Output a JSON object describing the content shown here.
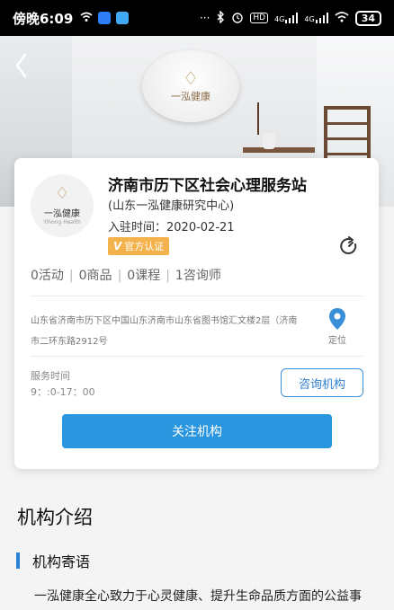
{
  "status_bar": {
    "time": "傍晚6:09",
    "dots": "···",
    "signal_1": "4G",
    "signal_2": "4G",
    "battery": "34"
  },
  "hero": {
    "plate_mark": "♢",
    "plate_brand": "一泓健康"
  },
  "org": {
    "avatar_mark": "♢",
    "avatar_brand": "一泓健康",
    "avatar_sub": "Yihong Health",
    "name": "济南市历下区社会心理服务站",
    "sub_name": "(山东一泓健康研究中心)",
    "join_label": "入驻时间：",
    "join_date": "2020-02-21",
    "badge_v": "V",
    "badge_text": "官方认证"
  },
  "stats": {
    "activities": "0活动",
    "products": "0商品",
    "courses": "0课程",
    "consultants": "1咨询师",
    "sep": "|"
  },
  "address": {
    "text": "山东省济南市历下区中国山东济南市山东省图书馆汇文楼2层（济南市二环东路2912号",
    "locate_label": "定位"
  },
  "hours": {
    "label": "服务时间",
    "value": "9：:0-17：00"
  },
  "buttons": {
    "consult": "咨询机构",
    "follow": "关注机构"
  },
  "section": {
    "title": "机构介绍",
    "sub_heading": "机构寄语",
    "intro": "一泓健康全心致力于心灵健康、提升生命品质方面的公益事"
  },
  "colors": {
    "accent": "#2a96df",
    "badge": "#f3b24c"
  }
}
